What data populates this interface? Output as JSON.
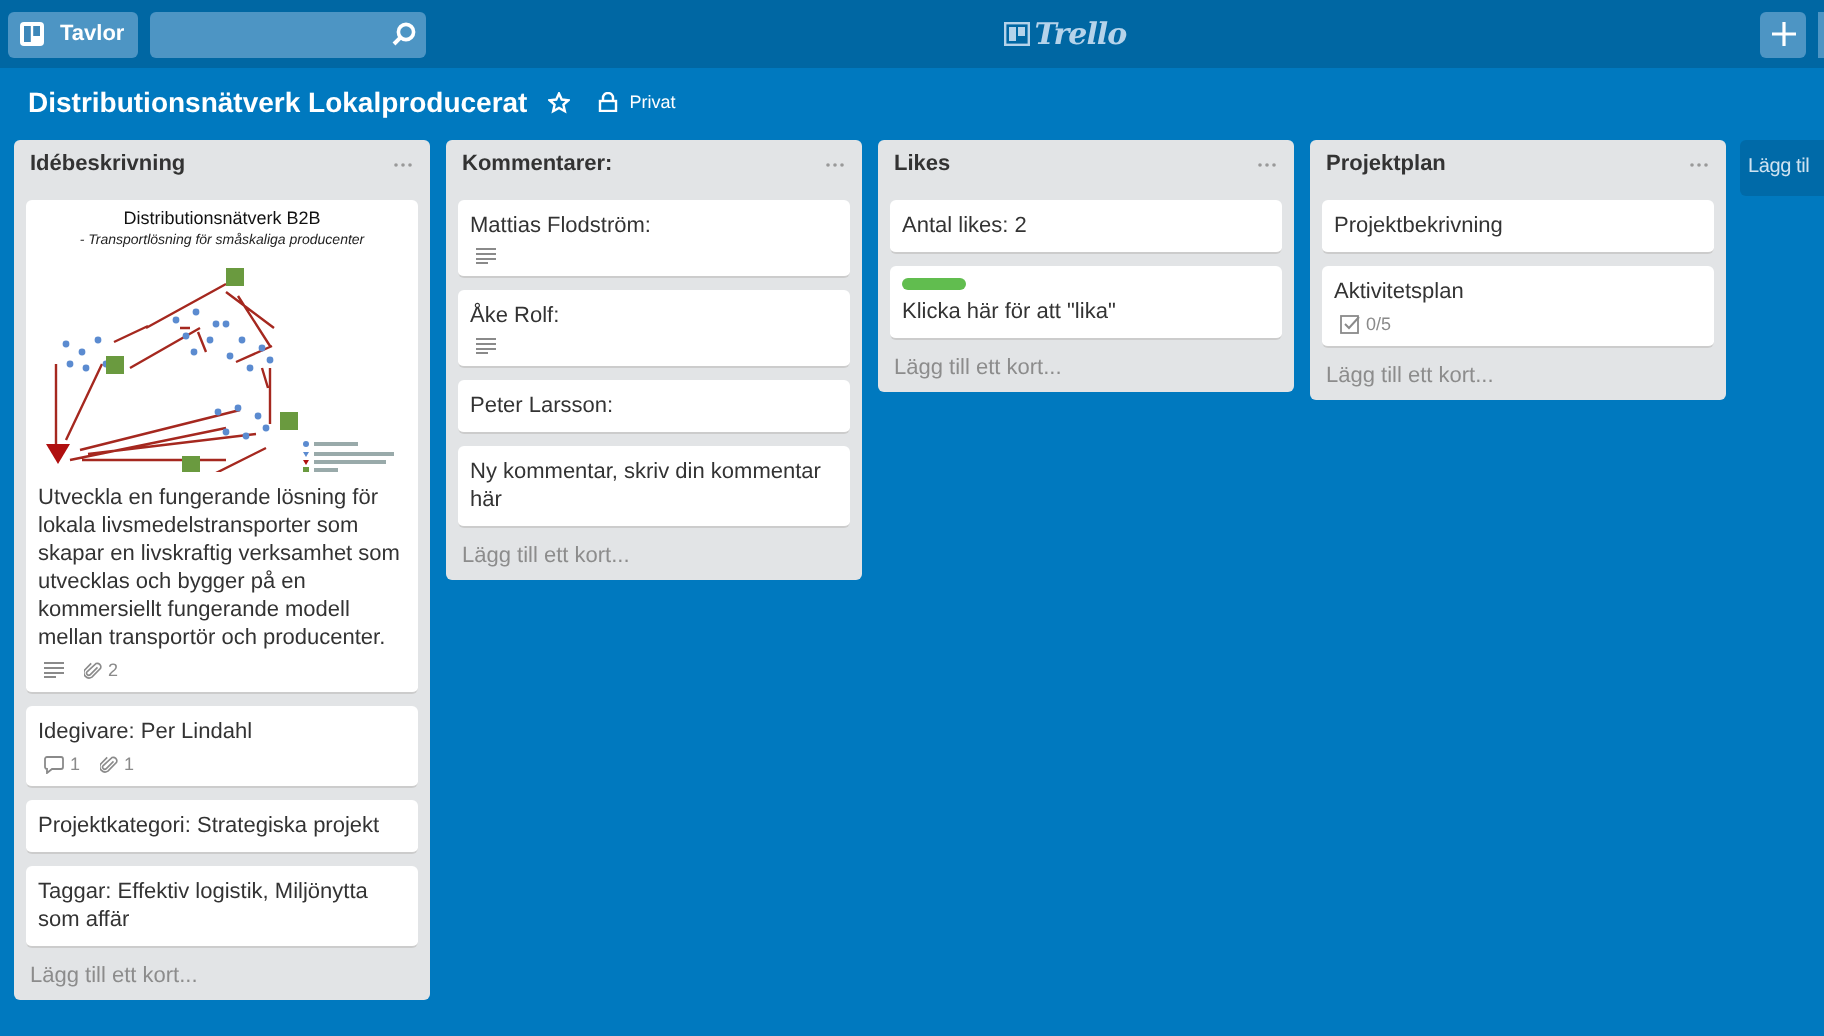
{
  "header": {
    "boards_button": "Tavlor",
    "logo": "Trello"
  },
  "board": {
    "title": "Distributionsnätverk Lokalproducerat",
    "visibility": "Privat"
  },
  "lists": [
    {
      "title": "Idébeskrivning",
      "add_card": "Lägg till ett kort...",
      "cards": [
        {
          "cover": {
            "title": "Distributionsnätverk B2B",
            "subtitle": "- Transportlösning för småskaliga producenter"
          },
          "title": "Utveckla en fungerande lösning för lokala livsmedelstransporter som skapar en livskraftig verksamhet som utvecklas och bygger på en kommersiellt fungerande modell mellan transportör och producenter.",
          "badges": [
            {
              "kind": "description"
            },
            {
              "kind": "attachment",
              "text": "2"
            }
          ]
        },
        {
          "title": "Idegivare: Per Lindahl",
          "badges": [
            {
              "kind": "comment",
              "text": "1"
            },
            {
              "kind": "attachment",
              "text": "1"
            }
          ]
        },
        {
          "title": "Projektkategori: Strategiska projekt"
        },
        {
          "title": "Taggar: Effektiv logistik, Miljönytta som affär"
        }
      ]
    },
    {
      "title": "Kommentarer:",
      "add_card": "Lägg till ett kort...",
      "cards": [
        {
          "title": "Mattias Flodström:",
          "badges": [
            {
              "kind": "description"
            }
          ]
        },
        {
          "title": "Åke Rolf:",
          "badges": [
            {
              "kind": "description"
            }
          ]
        },
        {
          "title": "Peter Larsson:"
        },
        {
          "title": "Ny kommentar, skriv din kommentar här"
        }
      ]
    },
    {
      "title": "Likes",
      "add_card": "Lägg till ett kort...",
      "cards": [
        {
          "title": "Antal likes: 2"
        },
        {
          "label": {
            "color": "#61bd4f"
          },
          "title": "Klicka här för att \"lika\""
        }
      ]
    },
    {
      "title": "Projektplan",
      "add_card": "Lägg till ett kort...",
      "cards": [
        {
          "title": "Projektbekrivning"
        },
        {
          "title": "Aktivitetsplan",
          "badges": [
            {
              "kind": "checklist",
              "text": "0/5"
            }
          ]
        }
      ]
    }
  ],
  "add_list": "Lägg til"
}
